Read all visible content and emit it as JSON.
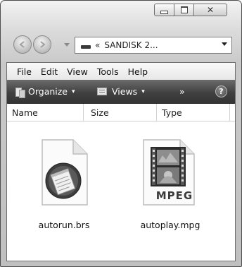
{
  "window": {
    "caption_buttons": {
      "minimize_icon": "minimize-icon",
      "maximize_icon": "maximize-icon",
      "close_icon": "close-icon",
      "close_glyph": "✕"
    }
  },
  "navigation": {
    "back_icon": "back-arrow-icon",
    "forward_icon": "forward-arrow-icon",
    "address": {
      "separator": "«",
      "crumb": "SANDISK 2...",
      "drive_icon": "drive-icon",
      "dropdown_icon": "chevron-down-icon"
    }
  },
  "menubar": {
    "items": [
      "File",
      "Edit",
      "View",
      "Tools",
      "Help"
    ]
  },
  "toolbar": {
    "organize_label": "Organize",
    "views_label": "Views",
    "more_label": "»",
    "help_label": "?",
    "caret": "▾"
  },
  "columns": {
    "headers": [
      "Name",
      "Size",
      "Type"
    ]
  },
  "files": [
    {
      "name": "autorun.brs",
      "icon": "notepad-document-icon"
    },
    {
      "name": "autoplay.mpg",
      "icon": "mpeg-video-icon",
      "badge": "MPEG"
    }
  ],
  "colors": {
    "toolbar_dark": "#404040",
    "window_frame": "#c9c9c9"
  }
}
